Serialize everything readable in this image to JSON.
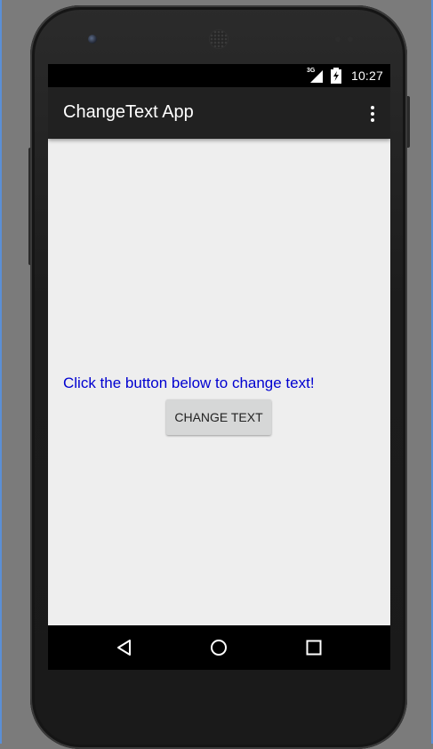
{
  "status_bar": {
    "network_label": "3G",
    "time": "10:27"
  },
  "app_bar": {
    "title": "ChangeText App",
    "overflow_icon": "more-vert-icon"
  },
  "content": {
    "message": "Click the button below to change text!",
    "button_label": "CHANGE TEXT"
  },
  "colors": {
    "app_bar": "#212121",
    "content_background": "#eeeeee",
    "message_text": "#0000d0",
    "button": "#d6d7d7"
  },
  "nav_bar": {
    "icons": [
      "back-icon",
      "home-icon",
      "recents-icon"
    ]
  }
}
